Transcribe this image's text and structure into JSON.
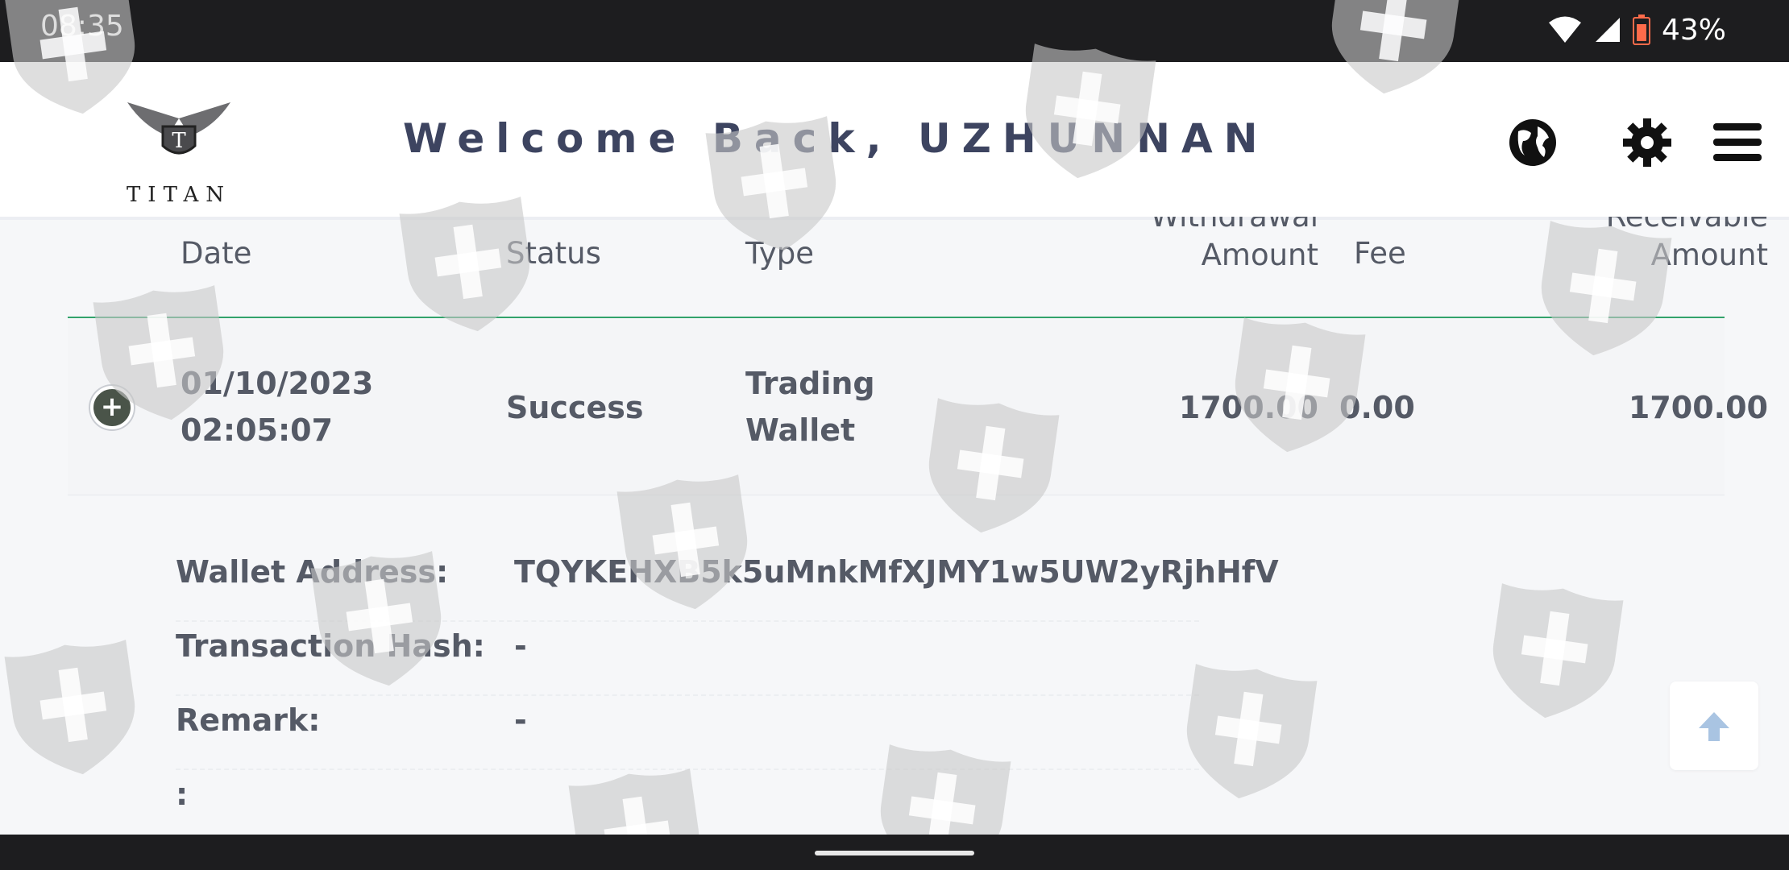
{
  "status_bar": {
    "time": "08:35",
    "battery": "43%",
    "icons": [
      "wifi-icon",
      "cell-signal-icon",
      "battery-low-icon"
    ]
  },
  "header": {
    "logo_text": "TITAN",
    "welcome": "Welcome Back, UZHUNNAN",
    "icons": [
      "globe-icon",
      "gear-icon",
      "menu-icon"
    ]
  },
  "table": {
    "columns": {
      "date": "Date",
      "status": "Status",
      "type": "Type",
      "withdrawal_top": "Withdrawal",
      "withdrawal_bottom": "Amount",
      "fee": "Fee",
      "receivable_top": "Receivable",
      "receivable_bottom": "Amount"
    },
    "row": {
      "date": "01/10/2023",
      "time": "02:05:07",
      "status": "Success",
      "type_line1": "Trading",
      "type_line2": "Wallet",
      "withdrawal_amount": "1700.00",
      "fee": "0.00",
      "receivable_amount": "1700.00"
    }
  },
  "details": {
    "wallet_address_label": "Wallet Address:",
    "wallet_address": "TQYKEHXB5k5uMnkMfXJMY1w5UW2yRjhHfV",
    "tx_hash_label": "Transaction Hash:",
    "tx_hash": "-",
    "remark_label": "Remark:",
    "remark": "-",
    "extra_label": ":"
  },
  "colors": {
    "accent_line": "#33a36b",
    "title": "#3d4460",
    "text": "#555a66",
    "bar": "#1d1d1f"
  }
}
